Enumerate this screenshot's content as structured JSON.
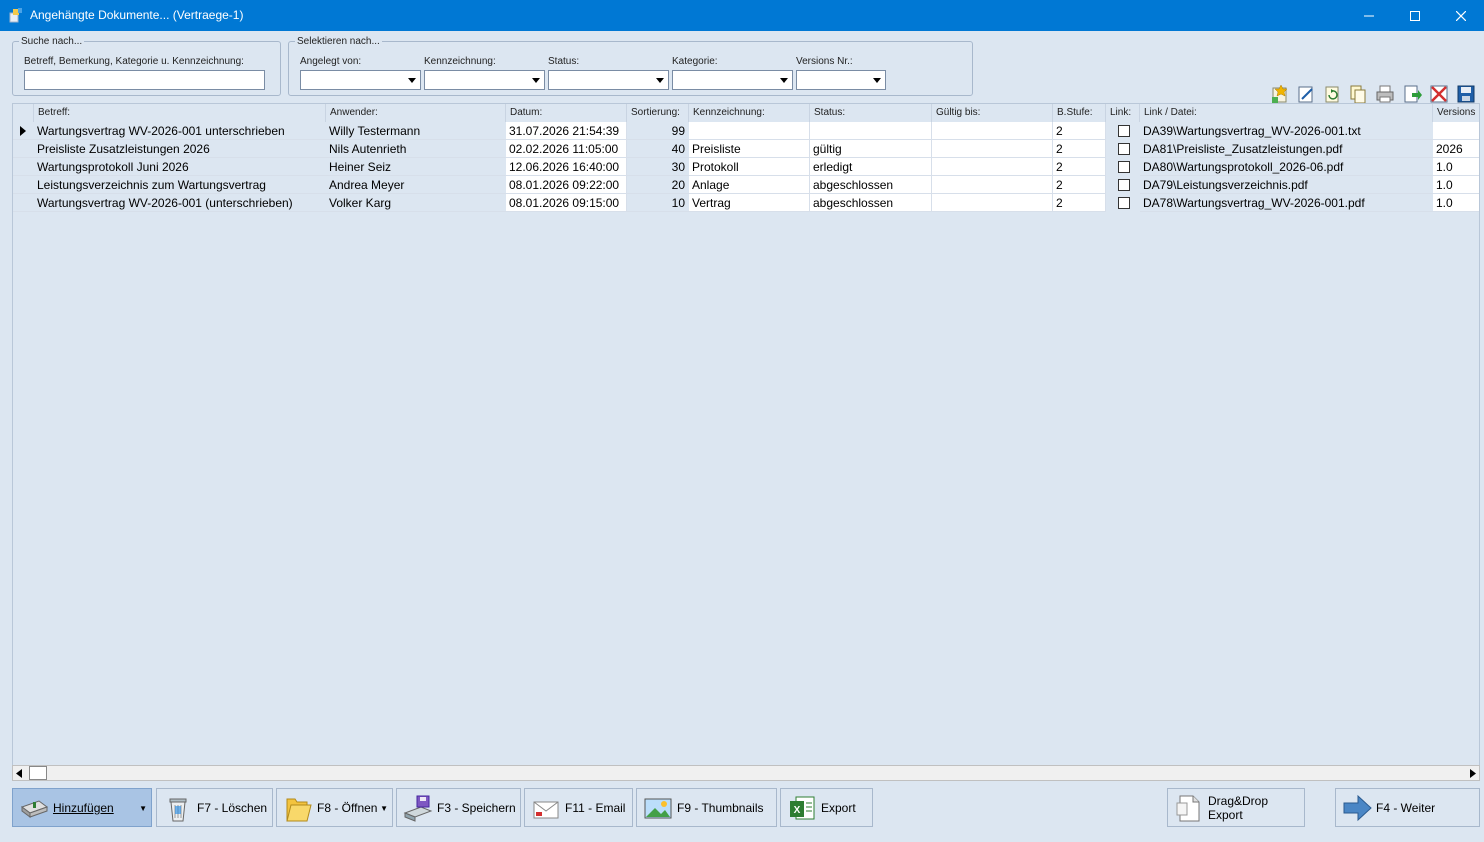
{
  "window": {
    "title": "Angehängte Dokumente... (Vertraege-1)",
    "controls": {
      "minimize": "—",
      "maximize": "☐",
      "close": "✕"
    }
  },
  "search": {
    "legend": "Suche nach...",
    "label": "Betreff, Bemerkung, Kategorie u. Kennzeichnung:",
    "value": ""
  },
  "filters": {
    "legend": "Selektieren nach...",
    "items": [
      {
        "label": "Angelegt von:",
        "value": ""
      },
      {
        "label": "Kennzeichnung:",
        "value": ""
      },
      {
        "label": "Status:",
        "value": ""
      },
      {
        "label": "Kategorie:",
        "value": ""
      },
      {
        "label": "Versions Nr.:",
        "value": ""
      }
    ]
  },
  "toolbar_icons": [
    "new-document-icon",
    "edit-icon",
    "refresh-icon",
    "copy-icon",
    "print-icon",
    "import-icon",
    "delete-icon",
    "save-icon"
  ],
  "table": {
    "columns": [
      "Betreff:",
      "Anwender:",
      "Datum:",
      "Sortierung:",
      "Kennzeichnung:",
      "Status:",
      "Gültig bis:",
      "B.Stufe:",
      "Link:",
      "Link / Datei:",
      "Versions"
    ],
    "rows": [
      {
        "betreff": "Wartungsvertrag WV-2026-001 unterschrieben",
        "anwender": "Willy Testermann",
        "datum": "31.07.2026 21:54:39",
        "sortierung": "99",
        "kennzeichnung": "",
        "status": "",
        "gueltig": "",
        "bstufe": "2",
        "link": false,
        "datei": "DA39\\Wartungsvertrag_WV-2026-001.txt",
        "version": ""
      },
      {
        "betreff": "Preisliste Zusatzleistungen 2026",
        "anwender": "Nils Autenrieth",
        "datum": "02.02.2026 11:05:00",
        "sortierung": "40",
        "kennzeichnung": "Preisliste",
        "status": "gültig",
        "gueltig": "",
        "bstufe": "2",
        "link": false,
        "datei": "DA81\\Preisliste_Zusatzleistungen.pdf",
        "version": "2026"
      },
      {
        "betreff": "Wartungsprotokoll Juni 2026",
        "anwender": "Heiner Seiz",
        "datum": "12.06.2026 16:40:00",
        "sortierung": "30",
        "kennzeichnung": "Protokoll",
        "status": "erledigt",
        "gueltig": "",
        "bstufe": "2",
        "link": false,
        "datei": "DA80\\Wartungsprotokoll_2026-06.pdf",
        "version": "1.0"
      },
      {
        "betreff": "Leistungsverzeichnis zum Wartungsvertrag",
        "anwender": "Andrea Meyer",
        "datum": "08.01.2026 09:22:00",
        "sortierung": "20",
        "kennzeichnung": "Anlage",
        "status": "abgeschlossen",
        "gueltig": "",
        "bstufe": "2",
        "link": false,
        "datei": "DA79\\Leistungsverzeichnis.pdf",
        "version": "1.0"
      },
      {
        "betreff": "Wartungsvertrag WV-2026-001 (unterschrieben)",
        "anwender": "Volker Karg",
        "datum": "08.01.2026 09:15:00",
        "sortierung": "10",
        "kennzeichnung": "Vertrag",
        "status": "abgeschlossen",
        "gueltig": "",
        "bstufe": "2",
        "link": false,
        "datei": "DA78\\Wartungsvertrag_WV-2026-001.pdf",
        "version": "1.0"
      }
    ]
  },
  "buttons": {
    "add": "Hinzufügen",
    "delete": "F7 - Löschen",
    "open": "F8 - Öffnen",
    "save": "F3 - Speichern",
    "email": "F11 - Email",
    "thumbnails": "F9 - Thumbnails",
    "export": "Export",
    "dragdrop": "Drag&Drop Export",
    "next": "F4 - Weiter"
  }
}
